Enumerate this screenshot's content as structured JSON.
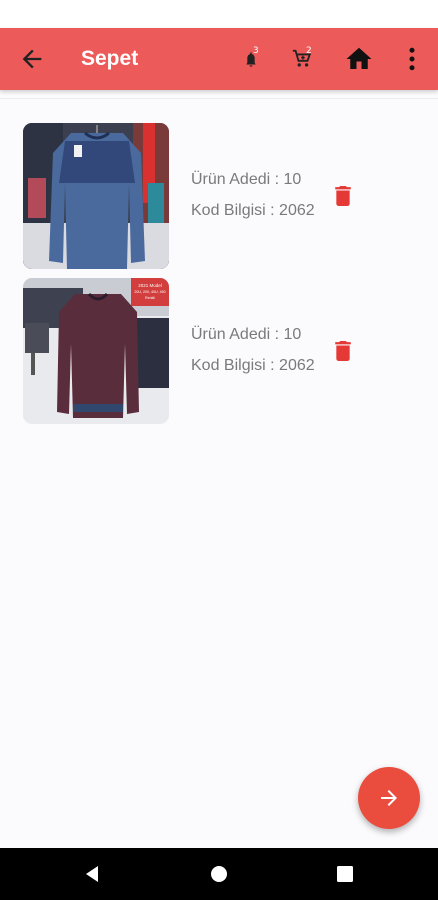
{
  "appbar": {
    "title": "Sepet",
    "notification_count": "3",
    "cart_count": "2"
  },
  "items": [
    {
      "adet": "Ürün Adedi : 10",
      "kod": "Kod Bilgisi : 2062"
    },
    {
      "adet": "Ürün Adedi : 10",
      "kod": "Kod Bilgisi : 2062"
    }
  ],
  "thumb_tag": {
    "line1": "2021 Model",
    "line2": "20U, 200, 40U, 450",
    "line3": "Renkli"
  },
  "colors": {
    "appbar": "#ec5a5a",
    "fab": "#ea4c3e",
    "trash": "#e53935",
    "text": "#7a7a7a"
  },
  "icons": {
    "back": "arrow-left-icon",
    "notifications": "bell-icon",
    "cart": "cart-icon",
    "home": "home-icon",
    "menu": "more-vert-icon",
    "delete": "trash-icon",
    "fab": "arrow-right-icon"
  }
}
